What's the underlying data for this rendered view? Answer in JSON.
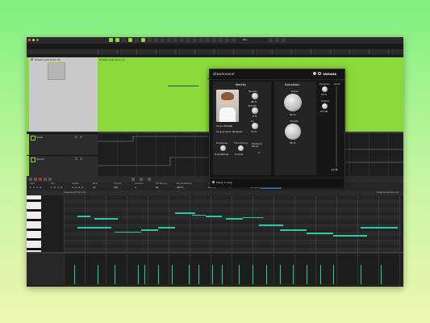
{
  "colors": {
    "accent": "#8bd83a",
    "note": "#27c9a6",
    "background_top": "#7ff07f",
    "background_bottom": "#eef7b0"
  },
  "toolbar": {
    "tempo_display": "Bar"
  },
  "tabs": [
    "Audio Inputs",
    "Audio Outputs",
    "Connected",
    "Grid Snap",
    "Quantize",
    "Drum Match",
    "Key Sound Tuner",
    "MIDI Insert Remote",
    "Active Track",
    "Project Cues",
    "Tempo Track",
    "Player Line Zoom",
    "Zoom Preset",
    "Buffer Use"
  ],
  "tracks": [
    {
      "name": "Dreamvocal Voice 01"
    },
    {
      "name": "Vocal"
    },
    {
      "name": "Tempo"
    }
  ],
  "arrange": {
    "clip_label": "Dreamvocal Voice 01"
  },
  "plugin": {
    "brand": "dreamvocal",
    "maker": "YAMAHA",
    "identity_title": "Identity",
    "expression_title": "Expression",
    "singer_label": "Singer",
    "singer_value": "Female",
    "singing_style_label": "Singing Style",
    "singing_style_value": "Dynamic",
    "tension_label": "Tension",
    "tension_value": "48 %",
    "breath_label": "Breath",
    "breath_value": "0 %",
    "air_label": "Air",
    "air_value": "70 %",
    "transpose_label": "Transpose",
    "transpose_value": "0 semitones",
    "time_tuning_label": "Time Tuning",
    "time_tuning_value": "0 cents",
    "pitchbend_label": "Pitchbend Range",
    "pitchbend_value": "2",
    "power_label": "Power",
    "power_value": "30 %",
    "vibrato_label": "Vibrato",
    "vibrato_value": "50 %",
    "presence_label": "Presence",
    "presence_value": "10 %",
    "output_label": "Output",
    "output_value": "0.0 dB",
    "level_label": "Level",
    "level_value": "-inf dB",
    "status": "Ready to sing!"
  },
  "editor": {
    "fields": [
      "Start",
      "End",
      "Length",
      "Pitch",
      "Velocity",
      "Channel",
      "Off Velocity",
      "Play Probability",
      "Articulations",
      "Release Length",
      "Lyric"
    ],
    "values": [
      "1 . 1 . 1 . 0",
      "1 . 5 . 1 . 0",
      "4 . 0 . 0 . 0",
      "C3",
      "100",
      "1",
      "64",
      "100 %",
      "Normal",
      "0",
      "Sample Lyric"
    ],
    "part_label": "Dreamvocal Voice 01",
    "part_label_right": "Dreamvocal Voice 01"
  },
  "arrange_notes": [
    {
      "t": 0.23,
      "p": 0.62,
      "len": 0.1
    },
    {
      "t": 0.36,
      "p": 0.72,
      "len": 0.14
    },
    {
      "t": 0.56,
      "p": 0.58,
      "len": 0.07
    }
  ],
  "editor_notes": [
    {
      "t": 0.04,
      "p": 0.44,
      "len": 0.1
    },
    {
      "t": 0.15,
      "p": 0.36,
      "len": 0.08
    },
    {
      "t": 0.23,
      "p": 0.4,
      "len": 0.05
    },
    {
      "t": 0.28,
      "p": 0.44,
      "len": 0.05
    },
    {
      "t": 0.09,
      "p": 0.6,
      "len": 0.07
    },
    {
      "t": 0.04,
      "p": 0.64,
      "len": 0.04
    },
    {
      "t": 0.33,
      "p": 0.7,
      "len": 0.06
    },
    {
      "t": 0.38,
      "p": 0.66,
      "len": 0.04
    },
    {
      "t": 0.42,
      "p": 0.64,
      "len": 0.05
    },
    {
      "t": 0.48,
      "p": 0.6,
      "len": 0.05
    },
    {
      "t": 0.53,
      "p": 0.62,
      "len": 0.06
    },
    {
      "t": 0.58,
      "p": 0.48,
      "len": 0.07
    },
    {
      "t": 0.64,
      "p": 0.4,
      "len": 0.08
    },
    {
      "t": 0.72,
      "p": 0.34,
      "len": 0.08
    },
    {
      "t": 0.8,
      "p": 0.3,
      "len": 0.1
    },
    {
      "t": 0.88,
      "p": 0.44,
      "len": 0.11
    }
  ],
  "velocity_lines": [
    0.03,
    0.1,
    0.15,
    0.22,
    0.24,
    0.28,
    0.32,
    0.37,
    0.4,
    0.44,
    0.47,
    0.52,
    0.56,
    0.6,
    0.64,
    0.68,
    0.72,
    0.76,
    0.8,
    0.88,
    0.94
  ]
}
